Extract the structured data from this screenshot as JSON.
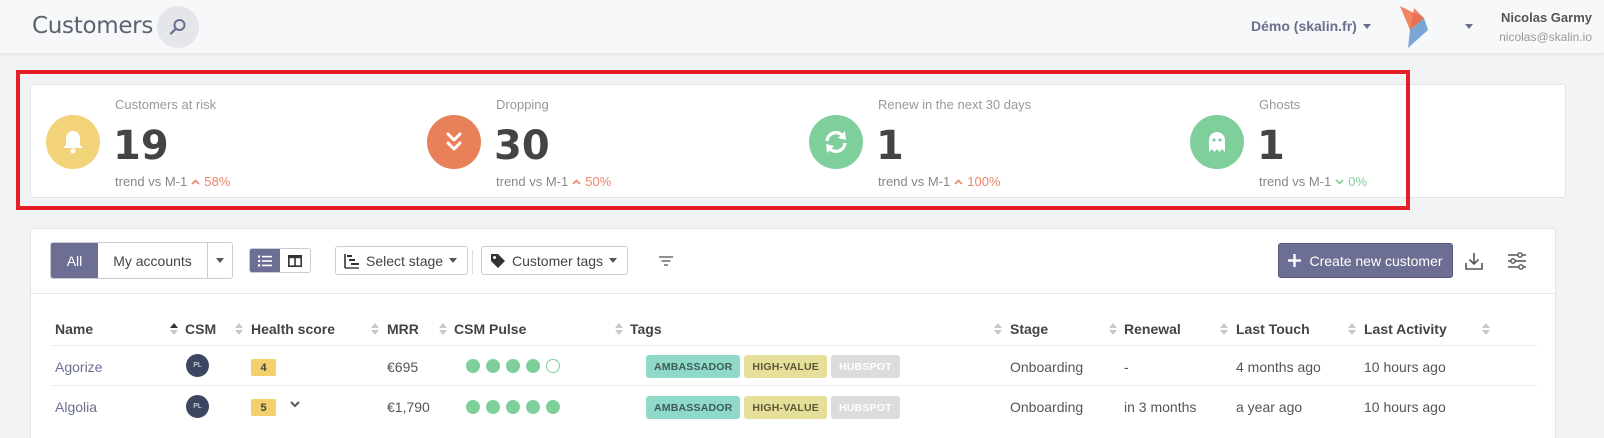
{
  "header": {
    "title": "Customers",
    "workspace": "Démo (skalin.fr)",
    "user_name": "Nicolas Garmy",
    "user_email": "nicolas@skalin.io"
  },
  "kpis": [
    {
      "label": "Customers at risk",
      "value": "19",
      "trend_label": "trend vs M-1",
      "trend_value": "58%",
      "direction": "up",
      "icon": "bell-icon",
      "color": "#f3d37a"
    },
    {
      "label": "Dropping",
      "value": "30",
      "trend_label": "trend vs M-1",
      "trend_value": "50%",
      "direction": "up",
      "icon": "chevrons-down-icon",
      "color": "#e8805a"
    },
    {
      "label": "Renew in the next 30 days",
      "value": "1",
      "trend_label": "trend vs M-1",
      "trend_value": "100%",
      "direction": "up",
      "icon": "refresh-icon",
      "color": "#7fcf9c"
    },
    {
      "label": "Ghosts",
      "value": "1",
      "trend_label": "trend vs M-1",
      "trend_value": "0%",
      "direction": "down",
      "icon": "ghost-icon",
      "color": "#7fcf9c"
    }
  ],
  "toolbar": {
    "all_label": "All",
    "my_accounts_label": "My accounts",
    "select_stage_label": "Select stage",
    "customer_tags_label": "Customer tags",
    "create_label": "Create new customer"
  },
  "table": {
    "columns": [
      "Name",
      "CSM",
      "Health score",
      "MRR",
      "CSM Pulse",
      "Tags",
      "Stage",
      "Renewal",
      "Last Touch",
      "Last Activity"
    ],
    "rows": [
      {
        "name": "Agorize",
        "csm": "PL",
        "health": "4",
        "mrr": "€695",
        "pulse": [
          1,
          1,
          1,
          1,
          0
        ],
        "tags": [
          "AMBASSADOR",
          "HIGH-VALUE",
          "HUBSPOT"
        ],
        "stage": "Onboarding",
        "renewal": "-",
        "last_touch": "4 months ago",
        "last_activity": "10 hours ago"
      },
      {
        "name": "Algolia",
        "csm": "PL",
        "health": "5",
        "mrr": "€1,790",
        "pulse": [
          1,
          1,
          1,
          1,
          1
        ],
        "tags": [
          "AMBASSADOR",
          "HIGH-VALUE",
          "HUBSPOT"
        ],
        "stage": "Onboarding",
        "renewal": "in 3 months",
        "last_touch": "a year ago",
        "last_activity": "10 hours ago"
      }
    ]
  },
  "colors": {
    "accent": "#6c6f93",
    "highlight_outline": "#e3202a",
    "tag_ambassador": "#8fd9c9",
    "tag_high_value": "#e5df9a",
    "tag_hubspot": "#dcdcdc"
  }
}
